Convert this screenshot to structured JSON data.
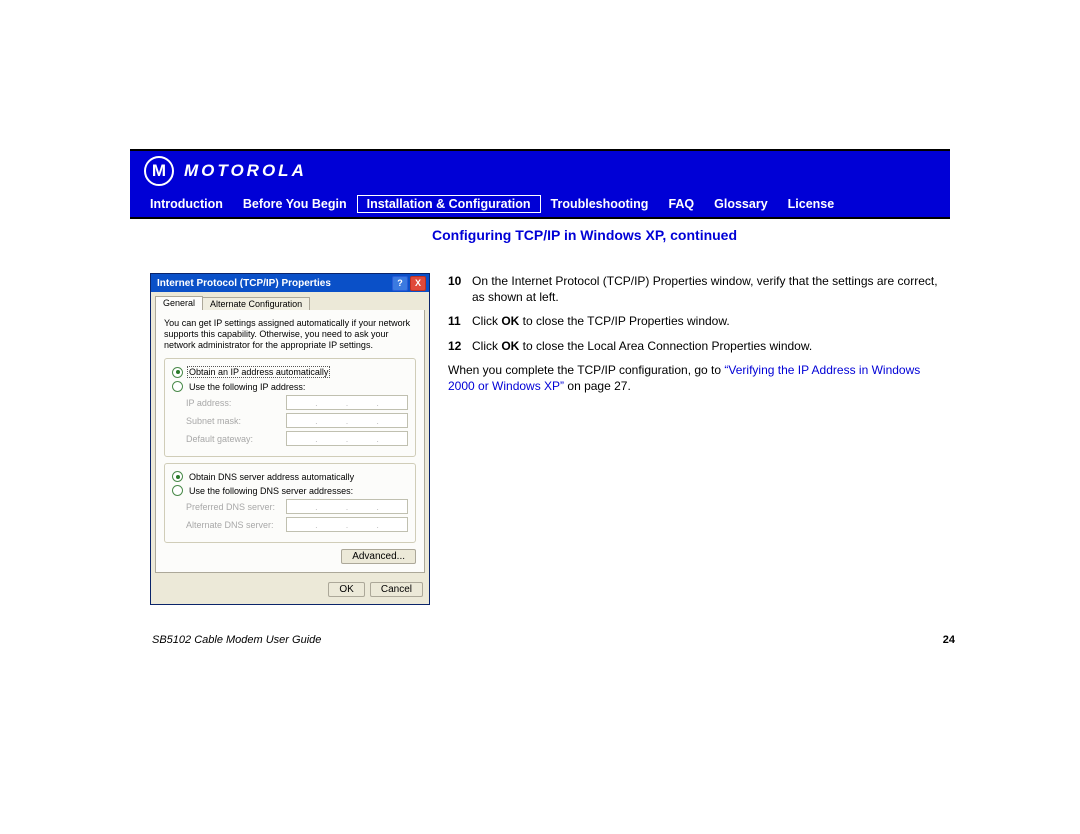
{
  "brand": "MOTOROLA",
  "nav": {
    "introduction": "Introduction",
    "before": "Before You Begin",
    "install": "Installation & Configuration",
    "trouble": "Troubleshooting",
    "faq": "FAQ",
    "glossary": "Glossary",
    "license": "License"
  },
  "section_title": "Configuring TCP/IP in Windows XP, continued",
  "dialog": {
    "title": "Internet Protocol (TCP/IP) Properties",
    "help_sym": "?",
    "close_sym": "X",
    "tabs": {
      "general": "General",
      "alt": "Alternate Configuration"
    },
    "desc": "You can get IP settings assigned automatically if your network supports this capability. Otherwise, you need to ask your network administrator for the appropriate IP settings.",
    "r_obtain_ip": "Obtain an IP address automatically",
    "r_use_ip": "Use the following IP address:",
    "f_ip": "IP address:",
    "f_mask": "Subnet mask:",
    "f_gw": "Default gateway:",
    "r_obtain_dns": "Obtain DNS server address automatically",
    "r_use_dns": "Use the following DNS server addresses:",
    "f_pdns": "Preferred DNS server:",
    "f_adns": "Alternate DNS server:",
    "advanced": "Advanced...",
    "ok": "OK",
    "cancel": "Cancel",
    "dots": ". . ."
  },
  "steps": {
    "n10": "10",
    "t10": "On the Internet Protocol (TCP/IP) Properties window, verify that the settings are correct, as shown at left.",
    "n11": "11",
    "t11a": "Click ",
    "t11b": "OK",
    "t11c": " to close the TCP/IP Properties window.",
    "n12": "12",
    "t12a": "Click ",
    "t12b": "OK",
    "t12c": " to close the Local Area Connection Properties window.",
    "after_a": "When you complete the TCP/IP configuration, go to ",
    "after_link": "“Verifying the IP Address in Windows 2000 or Windows XP”",
    "after_b": " on page 27."
  },
  "footer": {
    "guide": "SB5102 Cable Modem User Guide",
    "page": "24"
  }
}
